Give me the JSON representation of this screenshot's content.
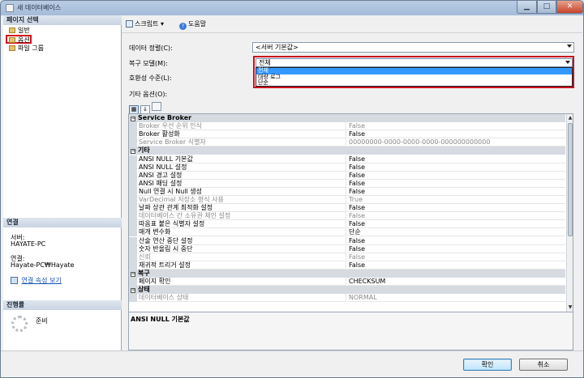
{
  "window": {
    "title": "새 데이터베이스"
  },
  "left": {
    "select_page_header": "페이지 선택",
    "pages": [
      {
        "label": "일반"
      },
      {
        "label": "옵션",
        "selected": true
      },
      {
        "label": "파일 그룹"
      }
    ],
    "connection_header": "연결",
    "server_label": "서버:",
    "server_value": "HAYATE-PC",
    "connection_label": "연결:",
    "connection_value": "Hayate-PC₩Hayate",
    "view_props_link": "연결 속성 보기",
    "progress_header": "진행률",
    "status": "준비"
  },
  "toolbar": {
    "script_label": "스크립트",
    "help_label": "도움말"
  },
  "form": {
    "collation_label": "데이터 정렬(C):",
    "collation_value": "<서버 기본값>",
    "recovery_label": "복구 모델(M):",
    "recovery_value": "전체",
    "recovery_options": [
      "전체",
      "대량 로그",
      "단순"
    ],
    "compat_label": "호환성 수준(L):",
    "other_label": "기타 옵션(O):"
  },
  "grid": {
    "rows": [
      {
        "type": "cat",
        "name": "Service Broker"
      },
      {
        "name": "Broker 우선 순위 인식",
        "value": "False",
        "ro": true
      },
      {
        "name": "Broker 활성화",
        "value": "False"
      },
      {
        "name": "Service Broker 식별자",
        "value": "00000000-0000-0000-0000-000000000000",
        "ro": true
      },
      {
        "type": "cat",
        "name": "기타"
      },
      {
        "name": "ANSI NULL 기본값",
        "value": "False"
      },
      {
        "name": "ANSI NULL 설정",
        "value": "False"
      },
      {
        "name": "ANSI 경고 설정",
        "value": "False"
      },
      {
        "name": "ANSI 패딩 설정",
        "value": "False"
      },
      {
        "name": "Null 연결 시 Null 생성",
        "value": "False"
      },
      {
        "name": "VarDecimal 저장소 형식 사용",
        "value": "True",
        "ro": true
      },
      {
        "name": "날짜 상관 관계 최적화 설정",
        "value": "False"
      },
      {
        "name": "데이터베이스 간 소유권 체인 설정",
        "value": "False",
        "ro": true
      },
      {
        "name": "따옴표 붙은 식별자 설정",
        "value": "False"
      },
      {
        "name": "매개 변수화",
        "value": "단순"
      },
      {
        "name": "산술 연산 중단 설정",
        "value": "False"
      },
      {
        "name": "숫자 반올림 시 중단",
        "value": "False"
      },
      {
        "name": "신뢰",
        "value": "False",
        "ro": true
      },
      {
        "name": "재귀적 트리거 설정",
        "value": "False"
      },
      {
        "type": "cat",
        "name": "복구"
      },
      {
        "name": "페이지 확인",
        "value": "CHECKSUM"
      },
      {
        "type": "cat",
        "name": "상태"
      },
      {
        "name": "데이터베이스 상태",
        "value": "NORMAL",
        "ro": true
      }
    ],
    "description_title": "ANSI NULL 기본값"
  },
  "footer": {
    "ok_label": "확인",
    "cancel_label": "취소"
  }
}
